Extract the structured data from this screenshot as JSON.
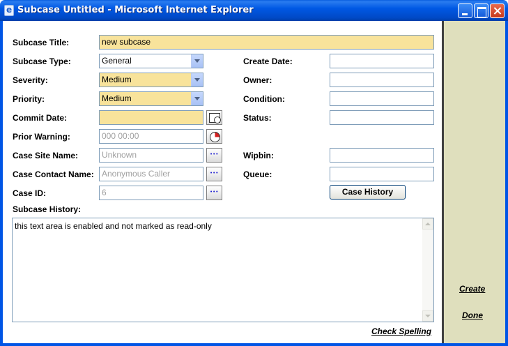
{
  "window": {
    "title": "Subcase Untitled - Microsoft Internet Explorer"
  },
  "form": {
    "subcase_title": {
      "label": "Subcase Title:",
      "value": "new subcase"
    },
    "subcase_type": {
      "label": "Subcase Type:",
      "value": "General"
    },
    "severity": {
      "label": "Severity:",
      "value": "Medium"
    },
    "priority": {
      "label": "Priority:",
      "value": "Medium"
    },
    "commit_date": {
      "label": "Commit Date:",
      "value": ""
    },
    "prior_warning": {
      "label": "Prior Warning:",
      "value": "000 00:00"
    },
    "case_site_name": {
      "label": "Case Site Name:",
      "value": "Unknown"
    },
    "case_contact_name": {
      "label": "Case Contact Name:",
      "value": "Anonymous Caller"
    },
    "case_id": {
      "label": "Case ID:",
      "value": "6"
    },
    "create_date": {
      "label": "Create Date:",
      "value": ""
    },
    "owner": {
      "label": "Owner:",
      "value": ""
    },
    "condition": {
      "label": "Condition:",
      "value": ""
    },
    "status": {
      "label": "Status:",
      "value": ""
    },
    "wipbin": {
      "label": "Wipbin:",
      "value": ""
    },
    "queue": {
      "label": "Queue:",
      "value": ""
    },
    "case_history_button": "Case History",
    "subcase_history": {
      "label": "Subcase History:",
      "value": "this text area is enabled and not marked as read-only"
    },
    "check_spelling": "Check Spelling"
  },
  "side_actions": {
    "create": "Create",
    "done": "Done"
  },
  "colors": {
    "required_field": "#f8e39b",
    "side_pane": "#dfdfbd",
    "titlebar": "#0058e4"
  }
}
